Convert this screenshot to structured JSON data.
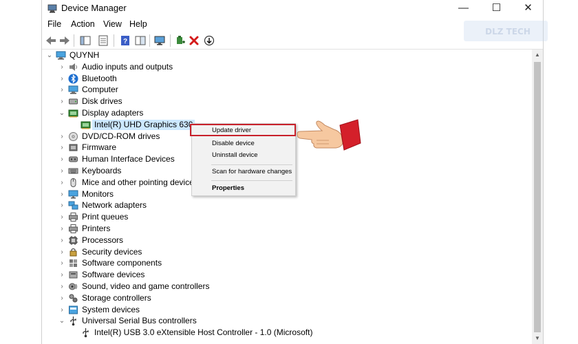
{
  "window": {
    "title": "Device Manager",
    "icon": "device-manager-icon"
  },
  "window_controls": {
    "minimize": "—",
    "maximize": "☐",
    "close": "✕"
  },
  "menu": [
    "File",
    "Action",
    "View",
    "Help"
  ],
  "watermark": {
    "text": "DLZ TECH"
  },
  "tree": {
    "root": "QUYNH",
    "items": [
      {
        "label": "Audio inputs and outputs",
        "icon": "speaker-icon"
      },
      {
        "label": "Bluetooth",
        "icon": "bluetooth-icon"
      },
      {
        "label": "Computer",
        "icon": "computer-icon"
      },
      {
        "label": "Disk drives",
        "icon": "disk-drive-icon"
      },
      {
        "label": "Display adapters",
        "icon": "display-adapter-icon",
        "expanded": true,
        "children": [
          {
            "label": "Intel(R) UHD Graphics 630",
            "icon": "display-adapter-icon",
            "selected": true
          }
        ]
      },
      {
        "label": "DVD/CD-ROM drives",
        "icon": "dvd-icon"
      },
      {
        "label": "Firmware",
        "icon": "firmware-icon"
      },
      {
        "label": "Human Interface Devices",
        "icon": "hid-icon"
      },
      {
        "label": "Keyboards",
        "icon": "keyboard-icon"
      },
      {
        "label": "Mice and other pointing devices",
        "icon": "mouse-icon"
      },
      {
        "label": "Monitors",
        "icon": "monitor-icon"
      },
      {
        "label": "Network adapters",
        "icon": "network-icon"
      },
      {
        "label": "Print queues",
        "icon": "printer-icon"
      },
      {
        "label": "Printers",
        "icon": "printer-icon"
      },
      {
        "label": "Processors",
        "icon": "processor-icon"
      },
      {
        "label": "Security devices",
        "icon": "security-icon"
      },
      {
        "label": "Software components",
        "icon": "software-component-icon"
      },
      {
        "label": "Software devices",
        "icon": "software-device-icon"
      },
      {
        "label": "Sound, video and game controllers",
        "icon": "sound-icon"
      },
      {
        "label": "Storage controllers",
        "icon": "storage-icon"
      },
      {
        "label": "System devices",
        "icon": "system-icon"
      },
      {
        "label": "Universal Serial Bus controllers",
        "icon": "usb-icon",
        "expanded": true,
        "children": [
          {
            "label": "Intel(R) USB 3.0 eXtensible Host Controller - 1.0 (Microsoft)",
            "icon": "usb-icon"
          }
        ]
      }
    ]
  },
  "context_menu": {
    "items": [
      "Update driver",
      "Disable device",
      "Uninstall device",
      "Scan for hardware changes",
      "Properties"
    ],
    "highlighted": "Update driver",
    "bold": "Properties"
  },
  "colors": {
    "highlight_box": "#c8202a",
    "selection": "#cce8ff",
    "hand_cuff": "#d4202a",
    "hand_skin": "#f6c8a0"
  }
}
